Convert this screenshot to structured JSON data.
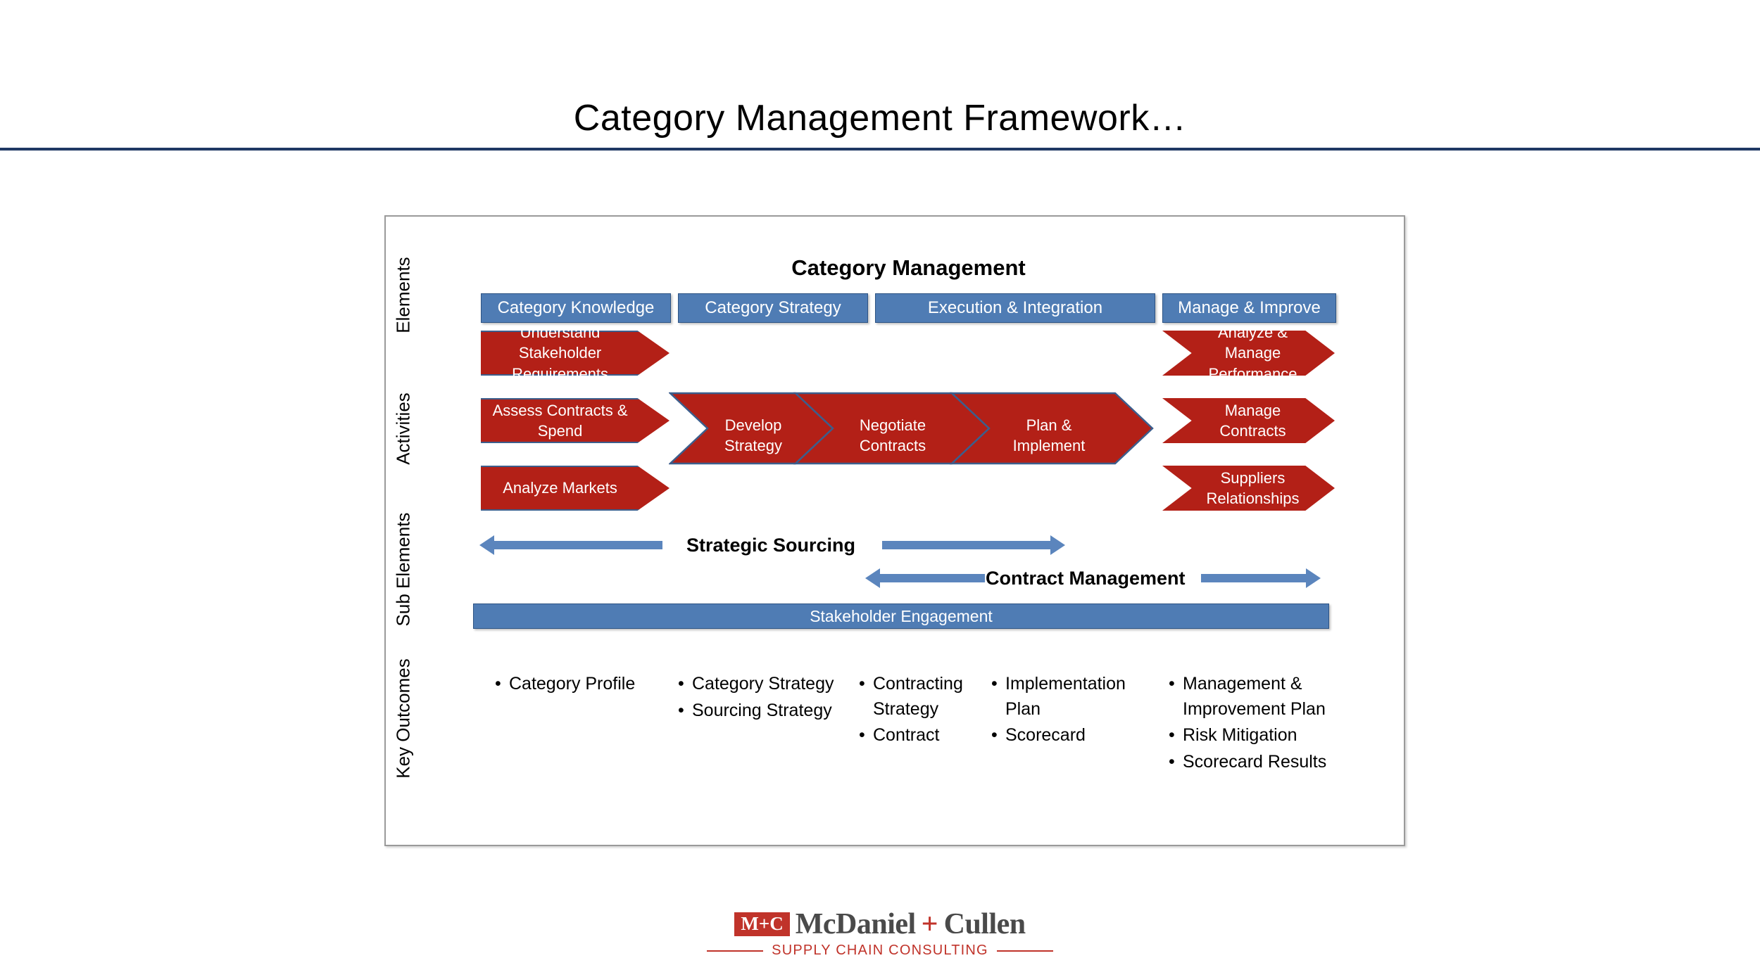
{
  "slide": {
    "title": "Category Management Framework…",
    "title_rule_color": "#1F3864"
  },
  "colors": {
    "blue": "#4F7CB4",
    "blue_border": "#2E5484",
    "red": "#B32017",
    "red_border": "#3C5E8C",
    "logo_red": "#C0332A",
    "logo_gray": "#4A4A4A",
    "container_border": "#9a9a9a"
  },
  "framework": {
    "heading": "Category Management",
    "row_labels": {
      "elements": "Elements",
      "activities": "Activities",
      "sub_elements": "Sub Elements",
      "key_outcomes": "Key Outcomes"
    },
    "elements": [
      {
        "label": "Category Knowledge"
      },
      {
        "label": "Category Strategy"
      },
      {
        "label": "Execution & Integration"
      },
      {
        "label": "Manage & Improve"
      }
    ],
    "activities": {
      "left": [
        {
          "label": "Understand\nStakeholder\nRequirements"
        },
        {
          "label": "Assess Contracts &\nSpend"
        },
        {
          "label": "Analyze Markets"
        }
      ],
      "middle": [
        {
          "label": "Develop\nStrategy"
        },
        {
          "label": "Negotiate\nContracts"
        },
        {
          "label": "Plan &\nImplement"
        }
      ],
      "right": [
        {
          "label": "Analyze &\nManage\nPerformance"
        },
        {
          "label": "Manage\nContracts"
        },
        {
          "label": "Suppliers\nRelationships"
        }
      ]
    },
    "sub_elements": {
      "strategic_sourcing": "Strategic Sourcing",
      "contract_management": "Contract Management",
      "stakeholder_engagement": "Stakeholder Engagement"
    },
    "key_outcomes": [
      {
        "items": [
          "Category Profile"
        ]
      },
      {
        "items": [
          "Category Strategy",
          "Sourcing Strategy"
        ]
      },
      {
        "items": [
          "Contracting Strategy",
          "Contract"
        ]
      },
      {
        "items": [
          "Implementation Plan",
          "Scorecard"
        ]
      },
      {
        "items": [
          "Management & Improvement Plan",
          "Risk Mitigation",
          "Scorecard Results"
        ]
      }
    ]
  },
  "footer": {
    "badge": "M+C",
    "name_first": "McDaniel",
    "name_plus": "+",
    "name_last": "Cullen",
    "tagline": "SUPPLY CHAIN CONSULTING"
  }
}
